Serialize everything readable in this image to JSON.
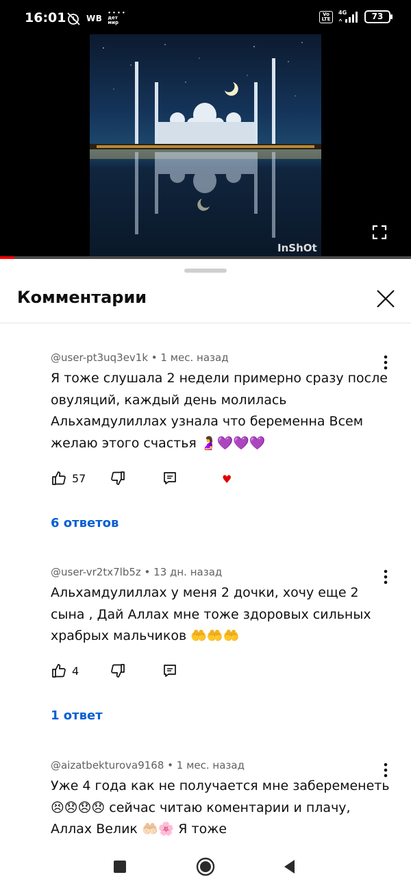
{
  "status_bar": {
    "time": "16:01",
    "left_label": "WB",
    "detmir_label": "• • • •\nдет\nмир",
    "volte_label": "Vo\nLTE",
    "network_label": "4G",
    "battery_level": "73"
  },
  "video": {
    "watermark": "InShOt",
    "progress_fraction": 0.035,
    "progress_color": "#ff0000"
  },
  "comments_sheet": {
    "title": "Комментарии"
  },
  "comments": [
    {
      "meta": "@user-pt3uq3ev1k • 1 мес. назад",
      "text": "Я тоже слушала 2 недели примерно сразу после овуляций, каждый день молилась Альхамдулиллах узнала что беременна Всем желаю этого счастья 🤰💜💜💜",
      "likes": "57",
      "creator_heart": true,
      "replies": "6 ответов"
    },
    {
      "meta": "@user-vr2tx7lb5z • 13 дн. назад",
      "text": "Альхамдулиллах у меня 2 дочки, хочу еще 2 сына , Дай Аллах мне тоже здоровых сильных храбрых мальчиков 🤲🤲🤲",
      "likes": "4",
      "creator_heart": false,
      "replies": "1 ответ"
    },
    {
      "meta": "@aizatbekturova9168 • 1 мес. назад",
      "text": "Уже 4 года как не получается мне забеременеть 😣😞😞😞 сейчас читаю коментарии и плачу, Аллах Велик 🤲🏻🌸 Я тоже",
      "likes": "",
      "creator_heart": false,
      "replies": ""
    }
  ],
  "icons": {
    "like": "thumb-up-icon",
    "dislike": "thumb-down-icon",
    "reply": "reply-icon",
    "more": "more-vert-icon",
    "close": "close-icon",
    "fullscreen": "fullscreen-icon",
    "heart": "creator-heart-icon"
  },
  "colors": {
    "accent_blue": "#065fd4",
    "heart_red": "#e00000",
    "text_primary": "#0f0f0f",
    "text_secondary": "#606060"
  }
}
